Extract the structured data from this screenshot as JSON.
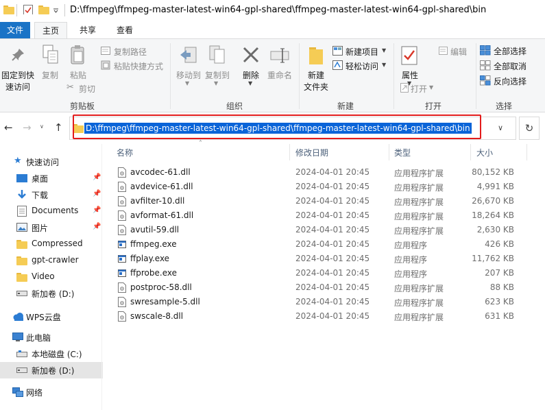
{
  "window": {
    "title_path": "D:\\ffmpeg\\ffmpeg-master-latest-win64-gpl-shared\\ffmpeg-master-latest-win64-gpl-shared\\bin"
  },
  "tabs": {
    "file": "文件",
    "home": "主页",
    "share": "共享",
    "view": "查看"
  },
  "ribbon": {
    "clipboard": {
      "pin_line1": "固定到快",
      "pin_line2": "速访问",
      "copy": "复制",
      "paste": "粘贴",
      "copy_path": "复制路径",
      "paste_shortcut": "粘贴快捷方式",
      "cut": "剪切",
      "label": "剪贴板"
    },
    "organize": {
      "move_to": "移动到",
      "copy_to": "复制到",
      "delete": "删除",
      "rename": "重命名",
      "label": "组织"
    },
    "new": {
      "new_folder_line1": "新建",
      "new_folder_line2": "文件夹",
      "new_item": "新建项目",
      "easy_access": "轻松访问",
      "label": "新建"
    },
    "open": {
      "properties": "属性",
      "open": "打开",
      "edit": "编辑",
      "label": "打开"
    },
    "select": {
      "select_all": "全部选择",
      "select_none": "全部取消",
      "invert": "反向选择",
      "label": "选择"
    }
  },
  "address": {
    "path": "D:\\ffmpeg\\ffmpeg-master-latest-win64-gpl-shared\\ffmpeg-master-latest-win64-gpl-shared\\bin",
    "highlight_color": "#e31b1b"
  },
  "sidebar": {
    "quick_access": "快速访问",
    "items": [
      {
        "label": "桌面",
        "icon": "desktop-icon",
        "pinned": true
      },
      {
        "label": "下载",
        "icon": "download-icon",
        "pinned": true
      },
      {
        "label": "Documents",
        "icon": "documents-icon",
        "pinned": true
      },
      {
        "label": "图片",
        "icon": "pictures-icon",
        "pinned": true
      },
      {
        "label": "Compressed",
        "icon": "folder-icon"
      },
      {
        "label": "gpt-crawler",
        "icon": "folder-icon"
      },
      {
        "label": "Video",
        "icon": "folder-icon"
      },
      {
        "label": "新加卷 (D:)",
        "icon": "drive-icon"
      }
    ],
    "wps": "WPS云盘",
    "this_pc": "此电脑",
    "pc_items": [
      {
        "label": "本地磁盘 (C:)",
        "icon": "drive-icon"
      },
      {
        "label": "新加卷 (D:)",
        "icon": "drive-icon",
        "selected": true
      }
    ],
    "network": "网络"
  },
  "columns": {
    "name": "名称",
    "date": "修改日期",
    "type": "类型",
    "size": "大小"
  },
  "files": [
    {
      "name": "avcodec-61.dll",
      "date": "2024-04-01 20:45",
      "type": "应用程序扩展",
      "size": "80,152 KB",
      "kind": "dll"
    },
    {
      "name": "avdevice-61.dll",
      "date": "2024-04-01 20:45",
      "type": "应用程序扩展",
      "size": "4,991 KB",
      "kind": "dll"
    },
    {
      "name": "avfilter-10.dll",
      "date": "2024-04-01 20:45",
      "type": "应用程序扩展",
      "size": "26,670 KB",
      "kind": "dll"
    },
    {
      "name": "avformat-61.dll",
      "date": "2024-04-01 20:45",
      "type": "应用程序扩展",
      "size": "18,264 KB",
      "kind": "dll"
    },
    {
      "name": "avutil-59.dll",
      "date": "2024-04-01 20:45",
      "type": "应用程序扩展",
      "size": "2,630 KB",
      "kind": "dll"
    },
    {
      "name": "ffmpeg.exe",
      "date": "2024-04-01 20:45",
      "type": "应用程序",
      "size": "426 KB",
      "kind": "exe"
    },
    {
      "name": "ffplay.exe",
      "date": "2024-04-01 20:45",
      "type": "应用程序",
      "size": "11,762 KB",
      "kind": "exe"
    },
    {
      "name": "ffprobe.exe",
      "date": "2024-04-01 20:45",
      "type": "应用程序",
      "size": "207 KB",
      "kind": "exe"
    },
    {
      "name": "postproc-58.dll",
      "date": "2024-04-01 20:45",
      "type": "应用程序扩展",
      "size": "88 KB",
      "kind": "dll"
    },
    {
      "name": "swresample-5.dll",
      "date": "2024-04-01 20:45",
      "type": "应用程序扩展",
      "size": "623 KB",
      "kind": "dll"
    },
    {
      "name": "swscale-8.dll",
      "date": "2024-04-01 20:45",
      "type": "应用程序扩展",
      "size": "631 KB",
      "kind": "dll"
    }
  ]
}
